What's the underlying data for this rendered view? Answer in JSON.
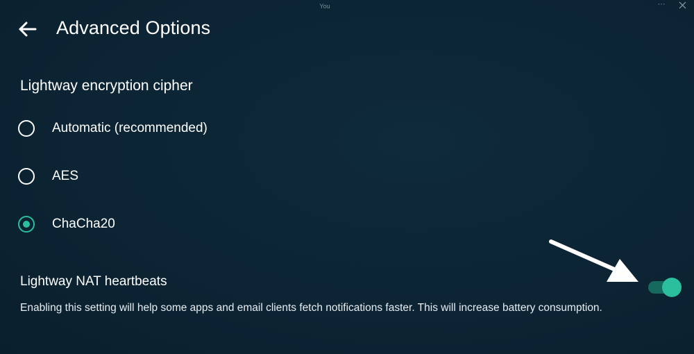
{
  "window": {
    "title": "You",
    "more_icon": "more-horizontal-icon",
    "close_icon": "close-icon"
  },
  "header": {
    "back_icon": "back-arrow-icon",
    "title": "Advanced Options"
  },
  "cipher_section": {
    "heading": "Lightway encryption cipher",
    "options": [
      {
        "label": "Automatic (recommended)",
        "selected": false
      },
      {
        "label": "AES",
        "selected": false
      },
      {
        "label": "ChaCha20",
        "selected": true
      }
    ]
  },
  "nat_heartbeats": {
    "title": "Lightway NAT heartbeats",
    "description": "Enabling this setting will help some apps and email clients fetch notifications faster. This will increase battery consumption.",
    "enabled": true
  },
  "annotation": {
    "arrow_icon": "pointer-arrow-icon"
  },
  "colors": {
    "background": "#0c2434",
    "accent": "#2bbf9e",
    "toggle_track": "#16695d",
    "text": "#ffffff"
  }
}
